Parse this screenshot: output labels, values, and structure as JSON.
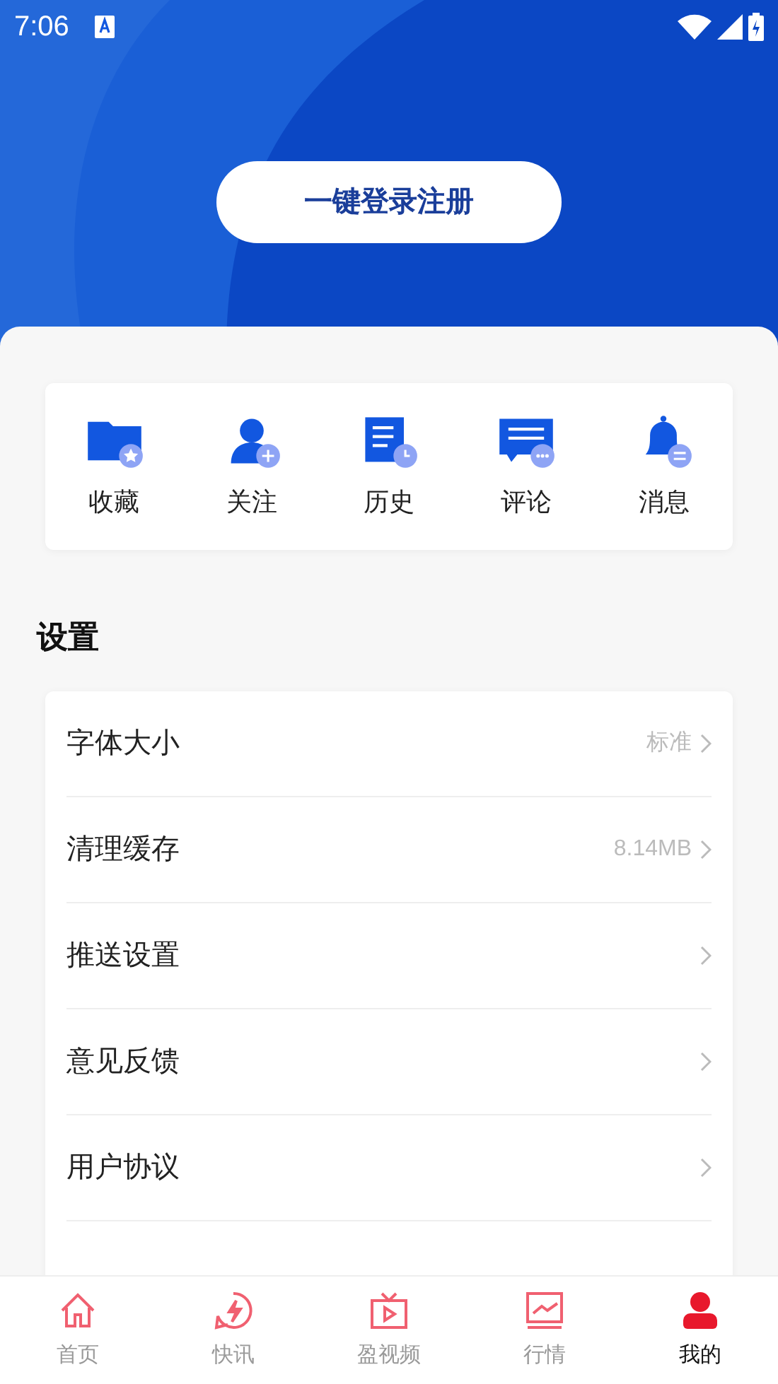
{
  "status_bar": {
    "time": "7:06"
  },
  "login_button": "一键登录注册",
  "shortcuts": [
    {
      "label": "收藏",
      "kind": "folder"
    },
    {
      "label": "关注",
      "kind": "follow"
    },
    {
      "label": "历史",
      "kind": "history"
    },
    {
      "label": "评论",
      "kind": "comment"
    },
    {
      "label": "消息",
      "kind": "bell"
    }
  ],
  "settings": {
    "title": "设置",
    "items": [
      {
        "label": "字体大小",
        "value": "标准"
      },
      {
        "label": "清理缓存",
        "value": "8.14MB"
      },
      {
        "label": "推送设置"
      },
      {
        "label": "意见反馈"
      },
      {
        "label": "用户协议"
      }
    ]
  },
  "tab_bar": [
    {
      "label": "首页",
      "kind": "home",
      "selected": false
    },
    {
      "label": "快讯",
      "kind": "flash",
      "selected": false
    },
    {
      "label": "盈视频",
      "kind": "tv",
      "selected": false
    },
    {
      "label": "行情",
      "kind": "chart",
      "selected": false
    },
    {
      "label": "我的",
      "kind": "user",
      "selected": true
    }
  ]
}
